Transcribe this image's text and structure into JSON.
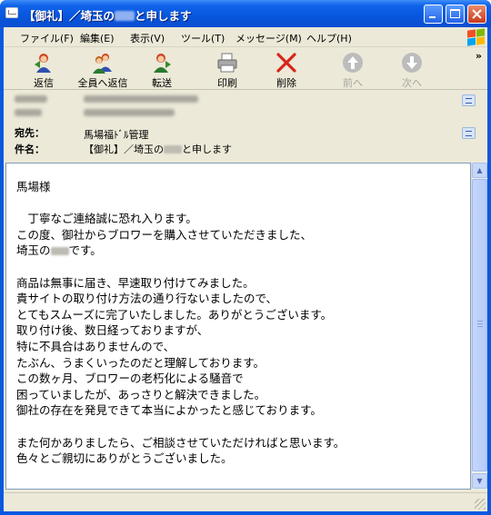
{
  "window": {
    "title_prefix": "【御礼】／埼玉の",
    "title_suffix": "と申します"
  },
  "menu": [
    "ファイル(F)",
    "編集(E)",
    "表示(V)",
    "ツール(T)",
    "メッセージ(M)",
    "ヘルプ(H)"
  ],
  "toolbar": {
    "reply": "返信",
    "reply_all": "全員へ返信",
    "forward": "転送",
    "print": "印刷",
    "delete": "削除",
    "prev": "前へ",
    "next": "次へ",
    "more": "»"
  },
  "headers": {
    "to_label": "宛先：",
    "to_value": "馬場福ﾄﾞﾙ管理",
    "subject_label": "件名：",
    "subject_prefix": "【御礼】／埼玉の",
    "subject_suffix": "と申します"
  },
  "body": {
    "salutation": "馬場様",
    "line_01": "　丁寧なご連絡誠に恐れ入ります。",
    "line_02": "この度、御社からブロワーを購入させていただきました、",
    "line_03_prefix": "埼玉の",
    "line_03_suffix": "です。",
    "line_04": "商品は無事に届き、早速取り付けてみました。",
    "line_05": "貴サイトの取り付け方法の通り行ないましたので、",
    "line_06": "とてもスムーズに完了いたしました。ありがとうございます。",
    "line_07": "取り付け後、数日経っておりますが、",
    "line_08": "特に不具合はありませんので、",
    "line_09": "たぶん、うまくいったのだと理解しております。",
    "line_10": "この数ヶ月、ブロワーの老朽化による騒音で",
    "line_11": "困っていましたが、あっさりと解決できました。",
    "line_12": "御社の存在を発見できて本当によかったと感じております。",
    "line_13": "また何かありましたら、ご相談させていただければと思います。",
    "line_14": "色々とご親切にありがとうございました。"
  },
  "icons": {
    "reply": "reply-icon",
    "reply_all": "reply-all-icon",
    "forward": "forward-icon",
    "print": "printer-icon",
    "delete": "delete-x-icon",
    "prev": "up-arrow-icon",
    "next": "down-arrow-icon"
  },
  "colors": {
    "titlebar": "#0a58e0",
    "chrome": "#ece9d8",
    "delete_red": "#d8261c"
  }
}
